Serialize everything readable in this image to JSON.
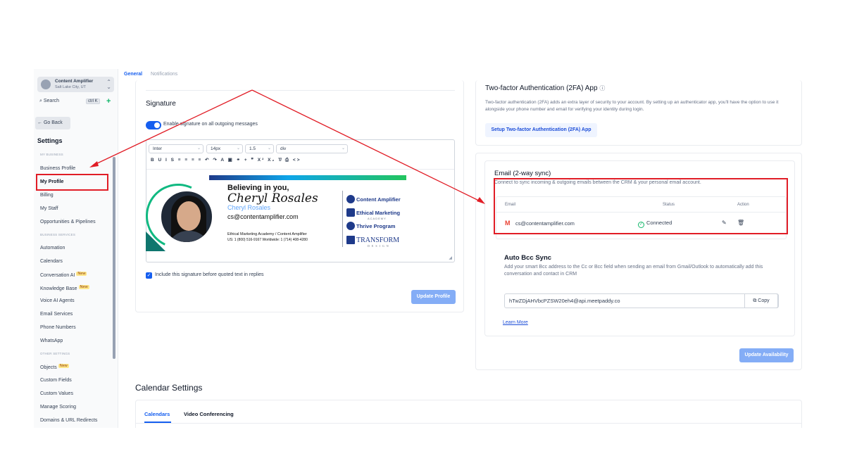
{
  "location": {
    "name": "Content Amplifier",
    "city": "Salt Lake City, UT"
  },
  "search": {
    "label": "Search",
    "shortcut": "ctrl K",
    "add": "+"
  },
  "go_back": "← Go Back",
  "settings_title": "Settings",
  "sections": {
    "my_business": "MY BUSINESS",
    "business_services": "BUSINESS SERVICES",
    "other_settings": "OTHER SETTINGS"
  },
  "nav": {
    "business_profile": "Business Profile",
    "my_profile": "My Profile",
    "billing": "Billing",
    "my_staff": "My Staff",
    "opportunities": "Opportunities & Pipelines",
    "automation": "Automation",
    "calendars": "Calendars",
    "conversation_ai": "Conversation AI",
    "knowledge_base": "Knowledge Base",
    "voice_ai": "Voice AI Agents",
    "email_services": "Email Services",
    "phone_numbers": "Phone Numbers",
    "whatsapp": "WhatsApp",
    "objects": "Objects",
    "custom_fields": "Custom Fields",
    "custom_values": "Custom Values",
    "manage_scoring": "Manage Scoring",
    "domains": "Domains & URL Redirects",
    "new_badge": "New"
  },
  "tabs": {
    "general": "General",
    "notifications": "Notifications"
  },
  "signature": {
    "title": "Signature",
    "toggle_label": "Enable signature on all outgoing messages",
    "font": "Inter",
    "size": "14px",
    "line_height": "1.5",
    "block": "div",
    "toolbar": "B U I S ≡ ≡ ≡ ≡ ↶ ↷ A ▣ ⚭ + ❞ X² X₂ T̸ ⎙ <>",
    "believing": "Believing in you,",
    "script_name": "Cheryl Rosales",
    "name": "Cheryl Rosales",
    "email": "cs@contentamplifier.com",
    "org": "Ethical Marketing Academy / Content Amplifier",
    "phones": "US: 1 (800) 516-9167     Worldwide: 1 (714) 408-4280",
    "logos": [
      "Content Amplifier",
      "Ethical Marketing",
      "Thrive Program",
      "TRANSFORM"
    ],
    "logo_subs": [
      "",
      "ACADEMY",
      "",
      "D E S I G N"
    ],
    "include_label": "Include this signature before quoted text in replies",
    "update_button": "Update Profile"
  },
  "twofa": {
    "title": "Two-factor Authentication (2FA) App",
    "info_icon": "ⓘ",
    "description": "Two-factor authentication (2FA) adds an extra layer of security to your account. By setting up an authenticator app, you'll have the option to use it alongside your phone number and email for verifying your identity during login.",
    "button": "Setup Two-factor Authentication (2FA) App"
  },
  "email_sync": {
    "title": "Email (2-way sync)",
    "description": "Connect to sync incoming & outgoing emails between the CRM & your personal email account.",
    "columns": {
      "email": "Email",
      "status": "Status",
      "action": "Action"
    },
    "row": {
      "email": "cs@contentamplifier.com",
      "status": "Connected"
    }
  },
  "bcc": {
    "title": "Auto Bcc Sync",
    "description": "Add your smart Bcc address to the Cc or Bcc field when sending an email from Gmail/Outlook to automatically add this conversation and contact in CRM",
    "address": "hTwZDjAHVbcPZSW20eh4@api.meetpaddy.co",
    "copy": "Copy",
    "learn_more": "Learn More",
    "update_button": "Update Availability"
  },
  "calendar": {
    "title": "Calendar Settings",
    "tabs": [
      "Calendars",
      "Video Conferencing"
    ]
  },
  "colors": {
    "accent": "#155eef",
    "annotation": "#e11d26",
    "connected": "#12b76a"
  }
}
